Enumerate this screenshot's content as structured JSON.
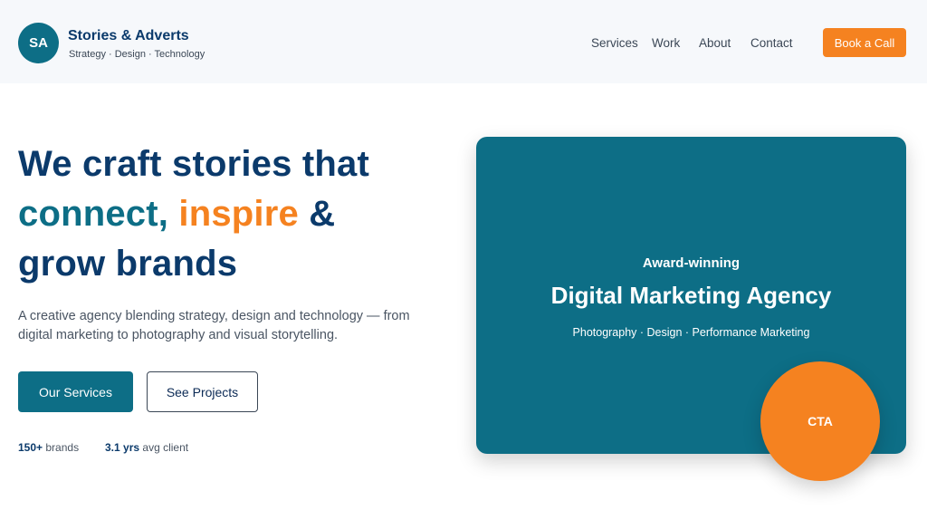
{
  "header": {
    "logo_initials": "SA",
    "brand_name": "Stories & Adverts",
    "brand_tagline": "Strategy · Design · Technology",
    "nav": [
      "Services",
      "Work",
      "About",
      "Contact"
    ],
    "cta_label": "Book a Call"
  },
  "hero": {
    "title_line1": "We craft stories that",
    "title_word_connect": "connect,",
    "title_word_inspire": "inspire",
    "title_amp": "&",
    "title_line3": "grow brands",
    "description": "A creative agency blending strategy, design and technology — from digital marketing to photography and visual storytelling.",
    "primary_button": "Our Services",
    "secondary_button": "See Projects",
    "stats": [
      {
        "value": "150+",
        "label": "brands"
      },
      {
        "value": "3.1 yrs",
        "label": "avg client"
      }
    ]
  },
  "card": {
    "kicker": "Award-winning",
    "title": "Digital Marketing Agency",
    "subtitle": "Photography · Design · Performance Marketing",
    "cta_label": "CTA"
  },
  "colors": {
    "navy": "#0b3a6b",
    "teal": "#0d6e86",
    "orange": "#f58220"
  }
}
